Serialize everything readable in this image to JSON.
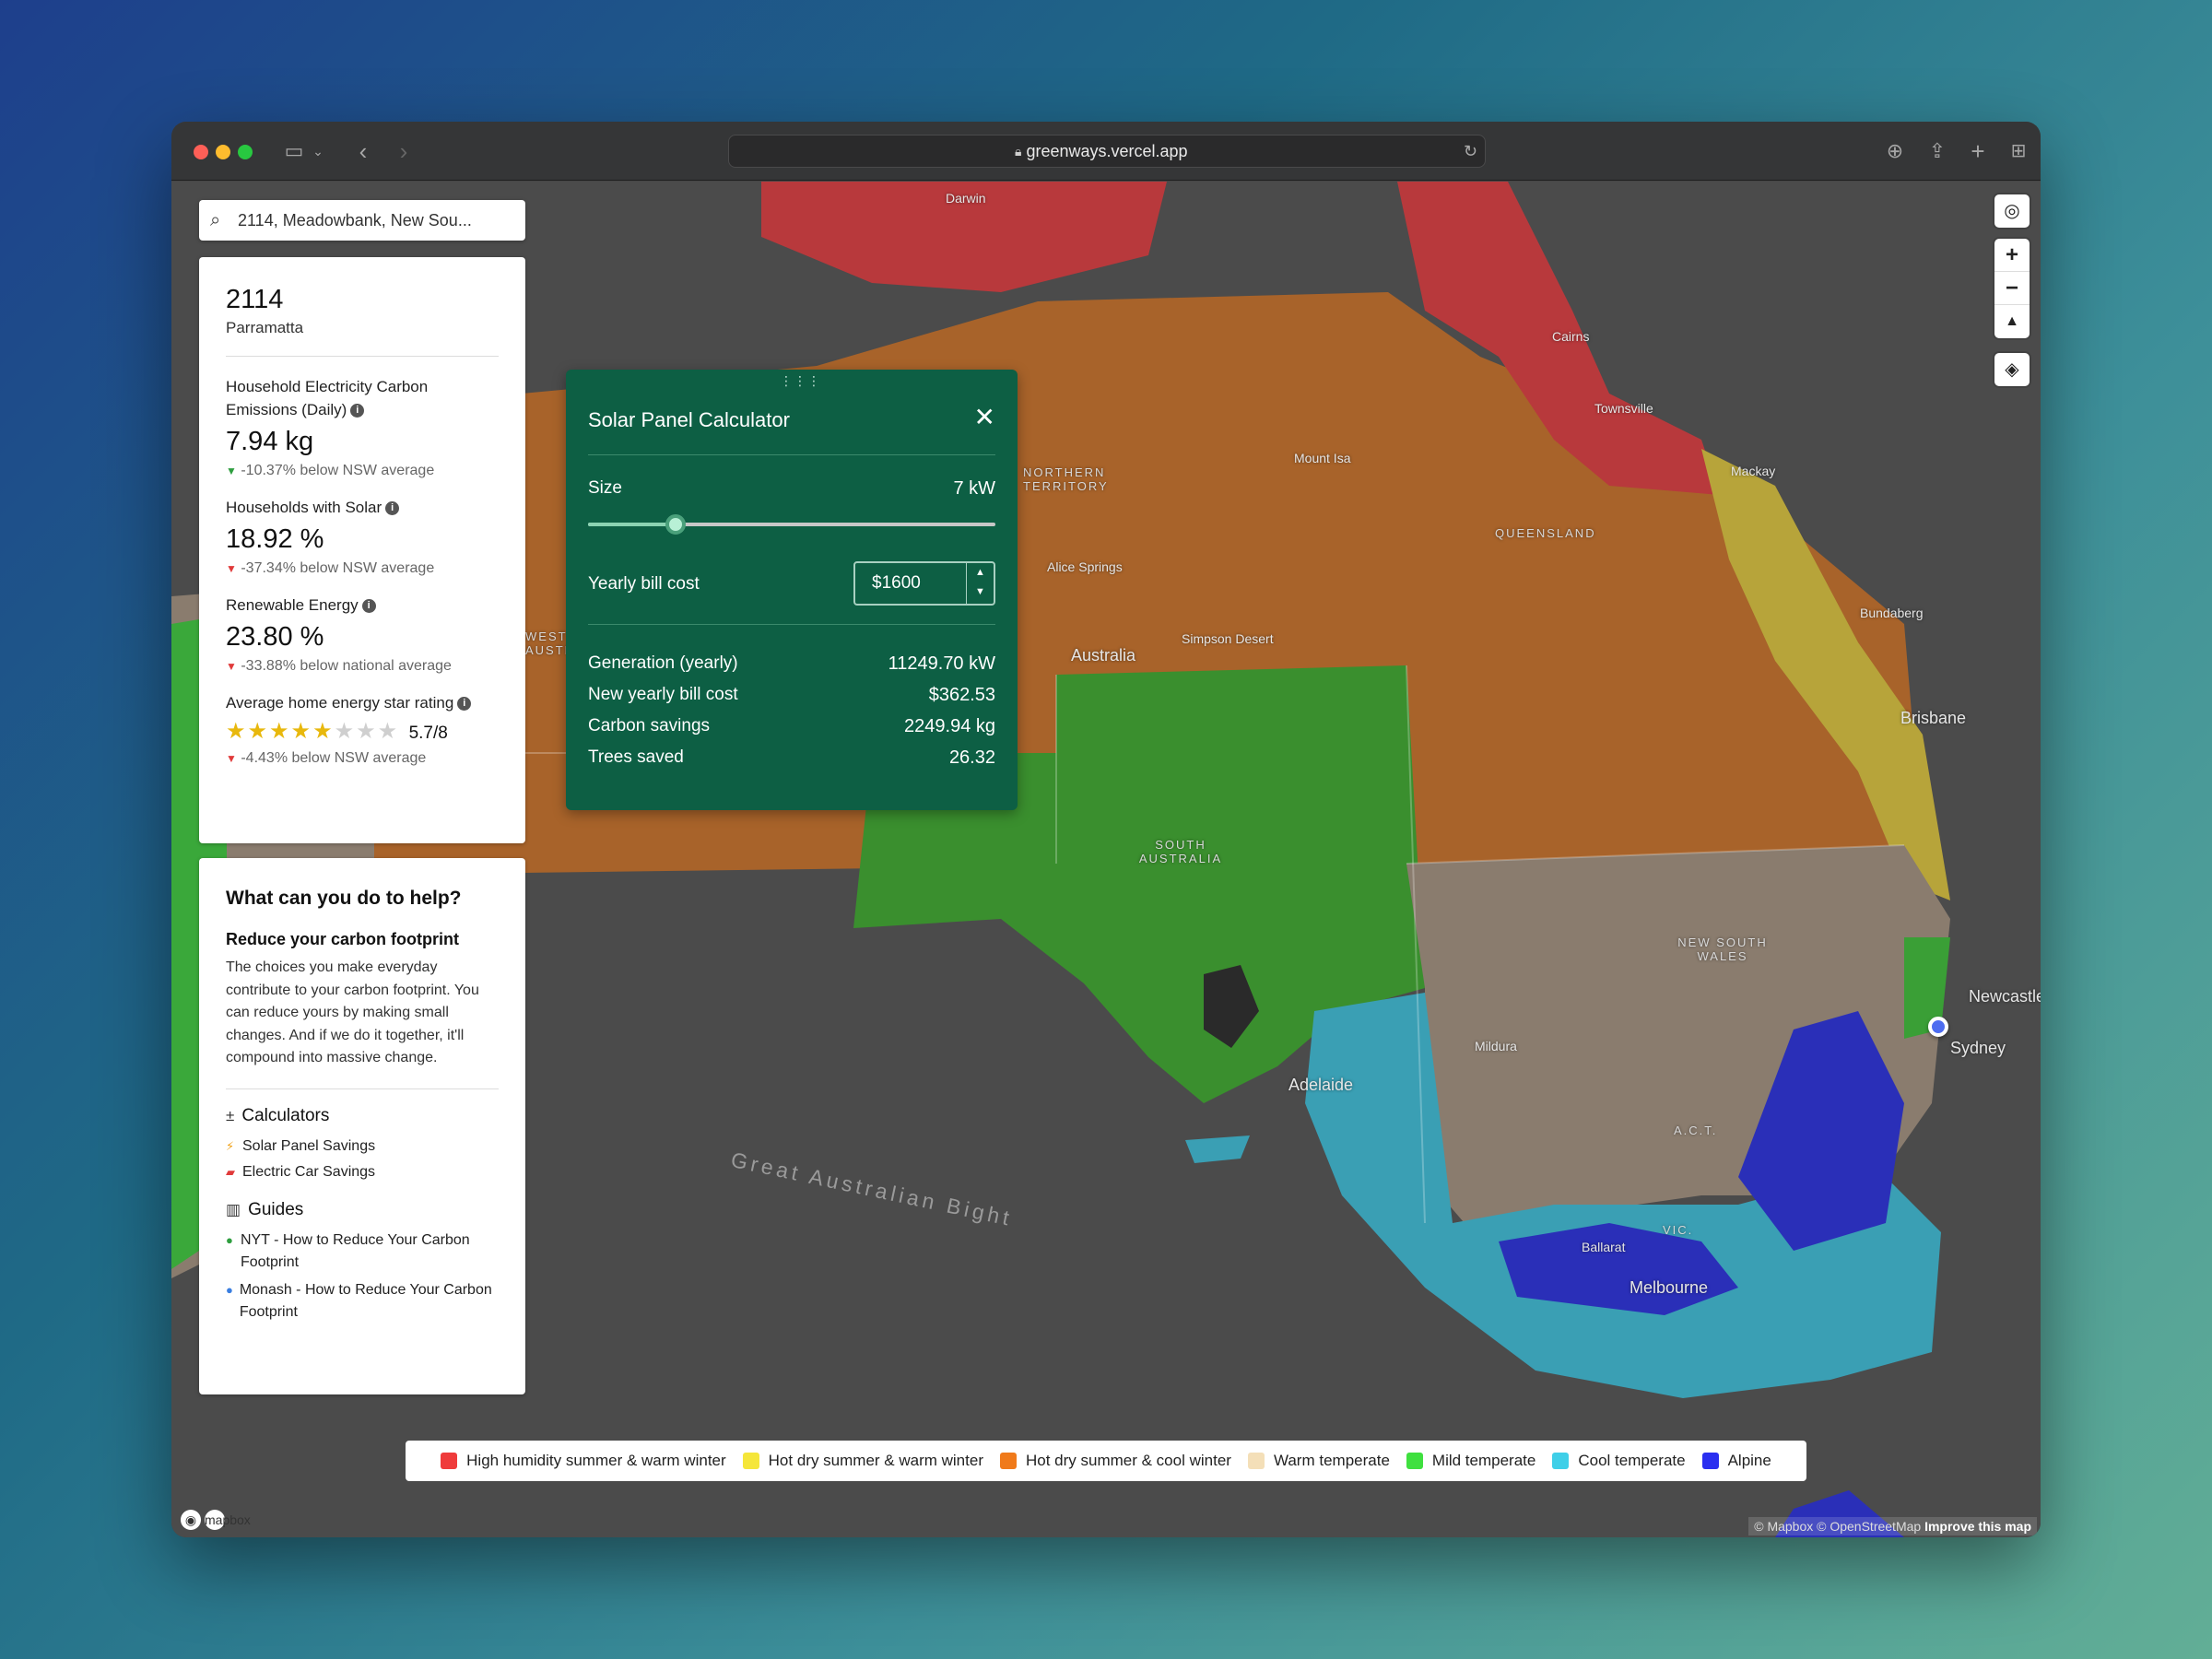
{
  "browser": {
    "url": "greenways.vercel.app"
  },
  "search": {
    "value": "2114, Meadowbank, New Sou..."
  },
  "stats": {
    "postcode": "2114",
    "suburb": "Parramatta",
    "emissions": {
      "label": "Household Electricity Carbon Emissions (Daily)",
      "value": "7.94 kg",
      "delta": "-10.37% below NSW average"
    },
    "solar": {
      "label": "Households with Solar",
      "value": "18.92 %",
      "delta": "-37.34% below NSW average"
    },
    "renewable": {
      "label": "Renewable Energy",
      "value": "23.80 %",
      "delta": "-33.88% below national average"
    },
    "star_rating": {
      "label": "Average home energy star rating",
      "value": "5.7/8",
      "rating": 5.7,
      "max": 8,
      "delta": "-4.43% below NSW average"
    }
  },
  "help": {
    "title": "What can you do to help?",
    "subtitle": "Reduce your carbon footprint",
    "text": "The choices you make everyday contribute to your carbon footprint. You can reduce yours by making small changes. And if we do it together, it'll compound into massive change.",
    "calculators_heading": "Calculators",
    "calculators": [
      "Solar Panel Savings",
      "Electric Car Savings"
    ],
    "guides_heading": "Guides",
    "guides": [
      "NYT - How to Reduce Your Carbon Footprint",
      "Monash - How to Reduce Your Carbon Footprint"
    ]
  },
  "calculator": {
    "title": "Solar Panel Calculator",
    "size_label": "Size",
    "size_value": "7 kW",
    "size_fraction": 0.216,
    "bill_label": "Yearly bill cost",
    "bill_value": "$1600",
    "results": [
      {
        "label": "Generation (yearly)",
        "value": "11249.70 kW"
      },
      {
        "label": "New yearly bill cost",
        "value": "$362.53"
      },
      {
        "label": "Carbon savings",
        "value": "2249.94 kg"
      },
      {
        "label": "Trees saved",
        "value": "26.32"
      }
    ]
  },
  "map": {
    "labels": [
      "Darwin",
      "Cairns",
      "Townsville",
      "Mackay",
      "Mount Isa",
      "Alice Springs",
      "Simpson Desert",
      "Australia",
      "Bundaberg",
      "Brisbane",
      "Newcastle",
      "Sydney",
      "Adelaide",
      "Melbourne",
      "Ballarat",
      "Mildura",
      "QUEENSLAND",
      "NORTHERN TERRITORY",
      "SOUTH AUSTRALIA",
      "NEW SOUTH WALES",
      "A.C.T.",
      "VIC.",
      "WEST AUSTR",
      "Great Australian Bight"
    ],
    "attribution": "© Mapbox © OpenStreetMap",
    "improve": "Improve this map",
    "logo": "mapbox"
  },
  "legend": [
    {
      "label": "High humidity summer & warm winter",
      "color": "#ef3b3b"
    },
    {
      "label": "Hot dry summer & warm winter",
      "color": "#f5e63a"
    },
    {
      "label": "Hot dry summer & cool winter",
      "color": "#f07a1a"
    },
    {
      "label": "Warm temperate",
      "color": "#f4dfb8"
    },
    {
      "label": "Mild temperate",
      "color": "#3fe03f"
    },
    {
      "label": "Cool temperate",
      "color": "#3fcfe8"
    },
    {
      "label": "Alpine",
      "color": "#2a2ff0"
    }
  ]
}
